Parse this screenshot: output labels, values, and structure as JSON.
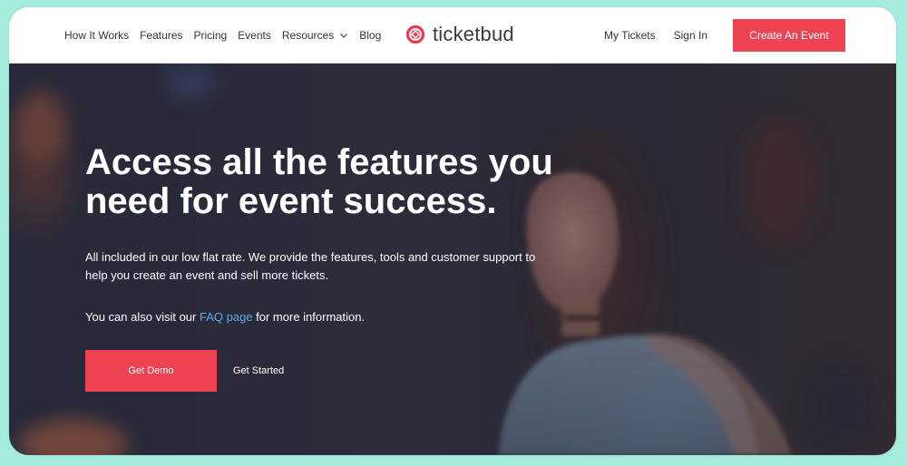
{
  "nav": {
    "links": [
      "How It Works",
      "Features",
      "Pricing",
      "Events",
      "Resources",
      "Blog"
    ],
    "brand": "ticketbud",
    "my_tickets": "My Tickets",
    "sign_in": "Sign In",
    "cta": "Create An Event"
  },
  "hero": {
    "title": "Access all the features you need for event success.",
    "description": "All included in our low flat rate. We provide the features, tools and customer support to help you create an event and sell more tickets.",
    "faq_prefix": "You can also visit our ",
    "faq_link": "FAQ page",
    "faq_suffix": " for more information.",
    "primary_button": "Get Demo",
    "secondary_button": "Get Started"
  },
  "colors": {
    "accent": "#ef4254",
    "link": "#5fa8e8",
    "frame": "#a6ecdd"
  },
  "icons": {
    "resources_dropdown": "chevron-down-icon",
    "logo": "ticketbud-logo-icon"
  }
}
